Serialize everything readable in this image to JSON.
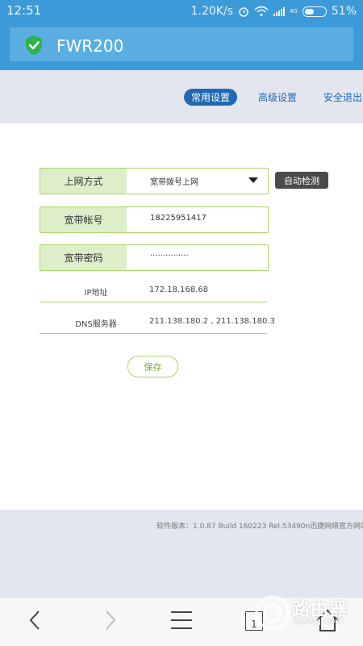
{
  "status_bar": {
    "time": "12:51",
    "speed": "1.20K/s",
    "network_small": "4G",
    "battery": "51%",
    "battery_level": 0.51
  },
  "app": {
    "title": "FWR200",
    "icon": "shield-check-icon",
    "icon_color": "#2db34a"
  },
  "nav": {
    "common": "常用设置",
    "advanced": "高级设置",
    "logout": "安全退出"
  },
  "form": {
    "mode_label": "上网方式",
    "mode_value": "宽带拨号上网",
    "auto_detect": "自动检测",
    "account_label": "宽带帐号",
    "account_value": "18225951417",
    "password_label": "宽带密码",
    "password_value": "...............",
    "ip_label": "IP地址",
    "ip_value": "172.18.168.68",
    "dns_label": "DNS服务器",
    "dns_value": "211.138.180.2 , 211.138.180.3",
    "save": "保存"
  },
  "footer": {
    "version": "软件版本：1.0.87 Build 160223 Rel.53490n",
    "site": "迅捷网络官方网站"
  },
  "browser": {
    "tab_count": "1",
    "icons": [
      "back-icon",
      "forward-icon",
      "menu-icon",
      "tabs-icon",
      "home-icon"
    ]
  },
  "watermark": {
    "title": "路由器",
    "sub": "luyouqi.com"
  },
  "colors": {
    "header": "#3d9ad8",
    "accent": "#1f6ab3",
    "green_border": "#a9d66a",
    "label_bg": "#dcefc9"
  }
}
